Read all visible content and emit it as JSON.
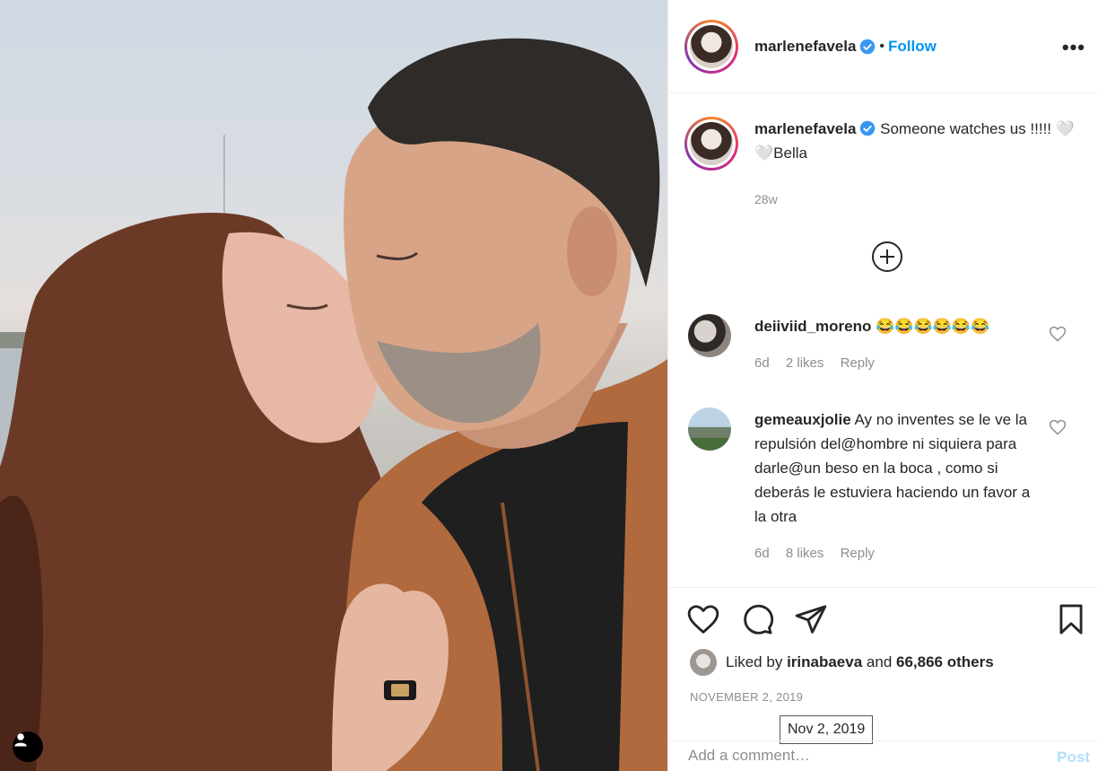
{
  "post": {
    "author": "marlenefavela",
    "follow_label": "Follow",
    "dot": "•",
    "more_label": "•••",
    "caption_text": "Someone watches us !!!!! 🤍🤍Bella",
    "time_ago": "28w",
    "likes_prefix": "Liked by",
    "likes_user": "irinabaeva",
    "likes_and": "and",
    "likes_count": "66,866 others",
    "date": "NOVEMBER 2, 2019",
    "date_tooltip": "Nov 2, 2019",
    "add_comment_placeholder": "Add a comment…",
    "post_label": "Post"
  },
  "comments": [
    {
      "user": "deiiviid_moreno",
      "text": "😂😂😂😂😂😂",
      "time": "6d",
      "likes": "2 likes",
      "reply": "Reply"
    },
    {
      "user": "gemeauxjolie",
      "text": "Ay no inventes se le ve la repulsión del@hombre ni siquiera para darle@un beso en la boca , como si deberás le estuviera haciendo un favor a la otra",
      "time": "6d",
      "likes": "8 likes",
      "reply": "Reply"
    }
  ],
  "icons": {
    "verified": "verified-badge-icon",
    "load_more": "plus-circle-icon",
    "like": "heart-icon",
    "comment": "comment-bubble-icon",
    "share": "paper-plane-icon",
    "save": "bookmark-icon",
    "tag": "user-tag-icon"
  },
  "colors": {
    "follow": "#0095f6",
    "verified": "#3897f0",
    "muted": "#8e8e8e",
    "post_disabled": "#b2dffc"
  }
}
